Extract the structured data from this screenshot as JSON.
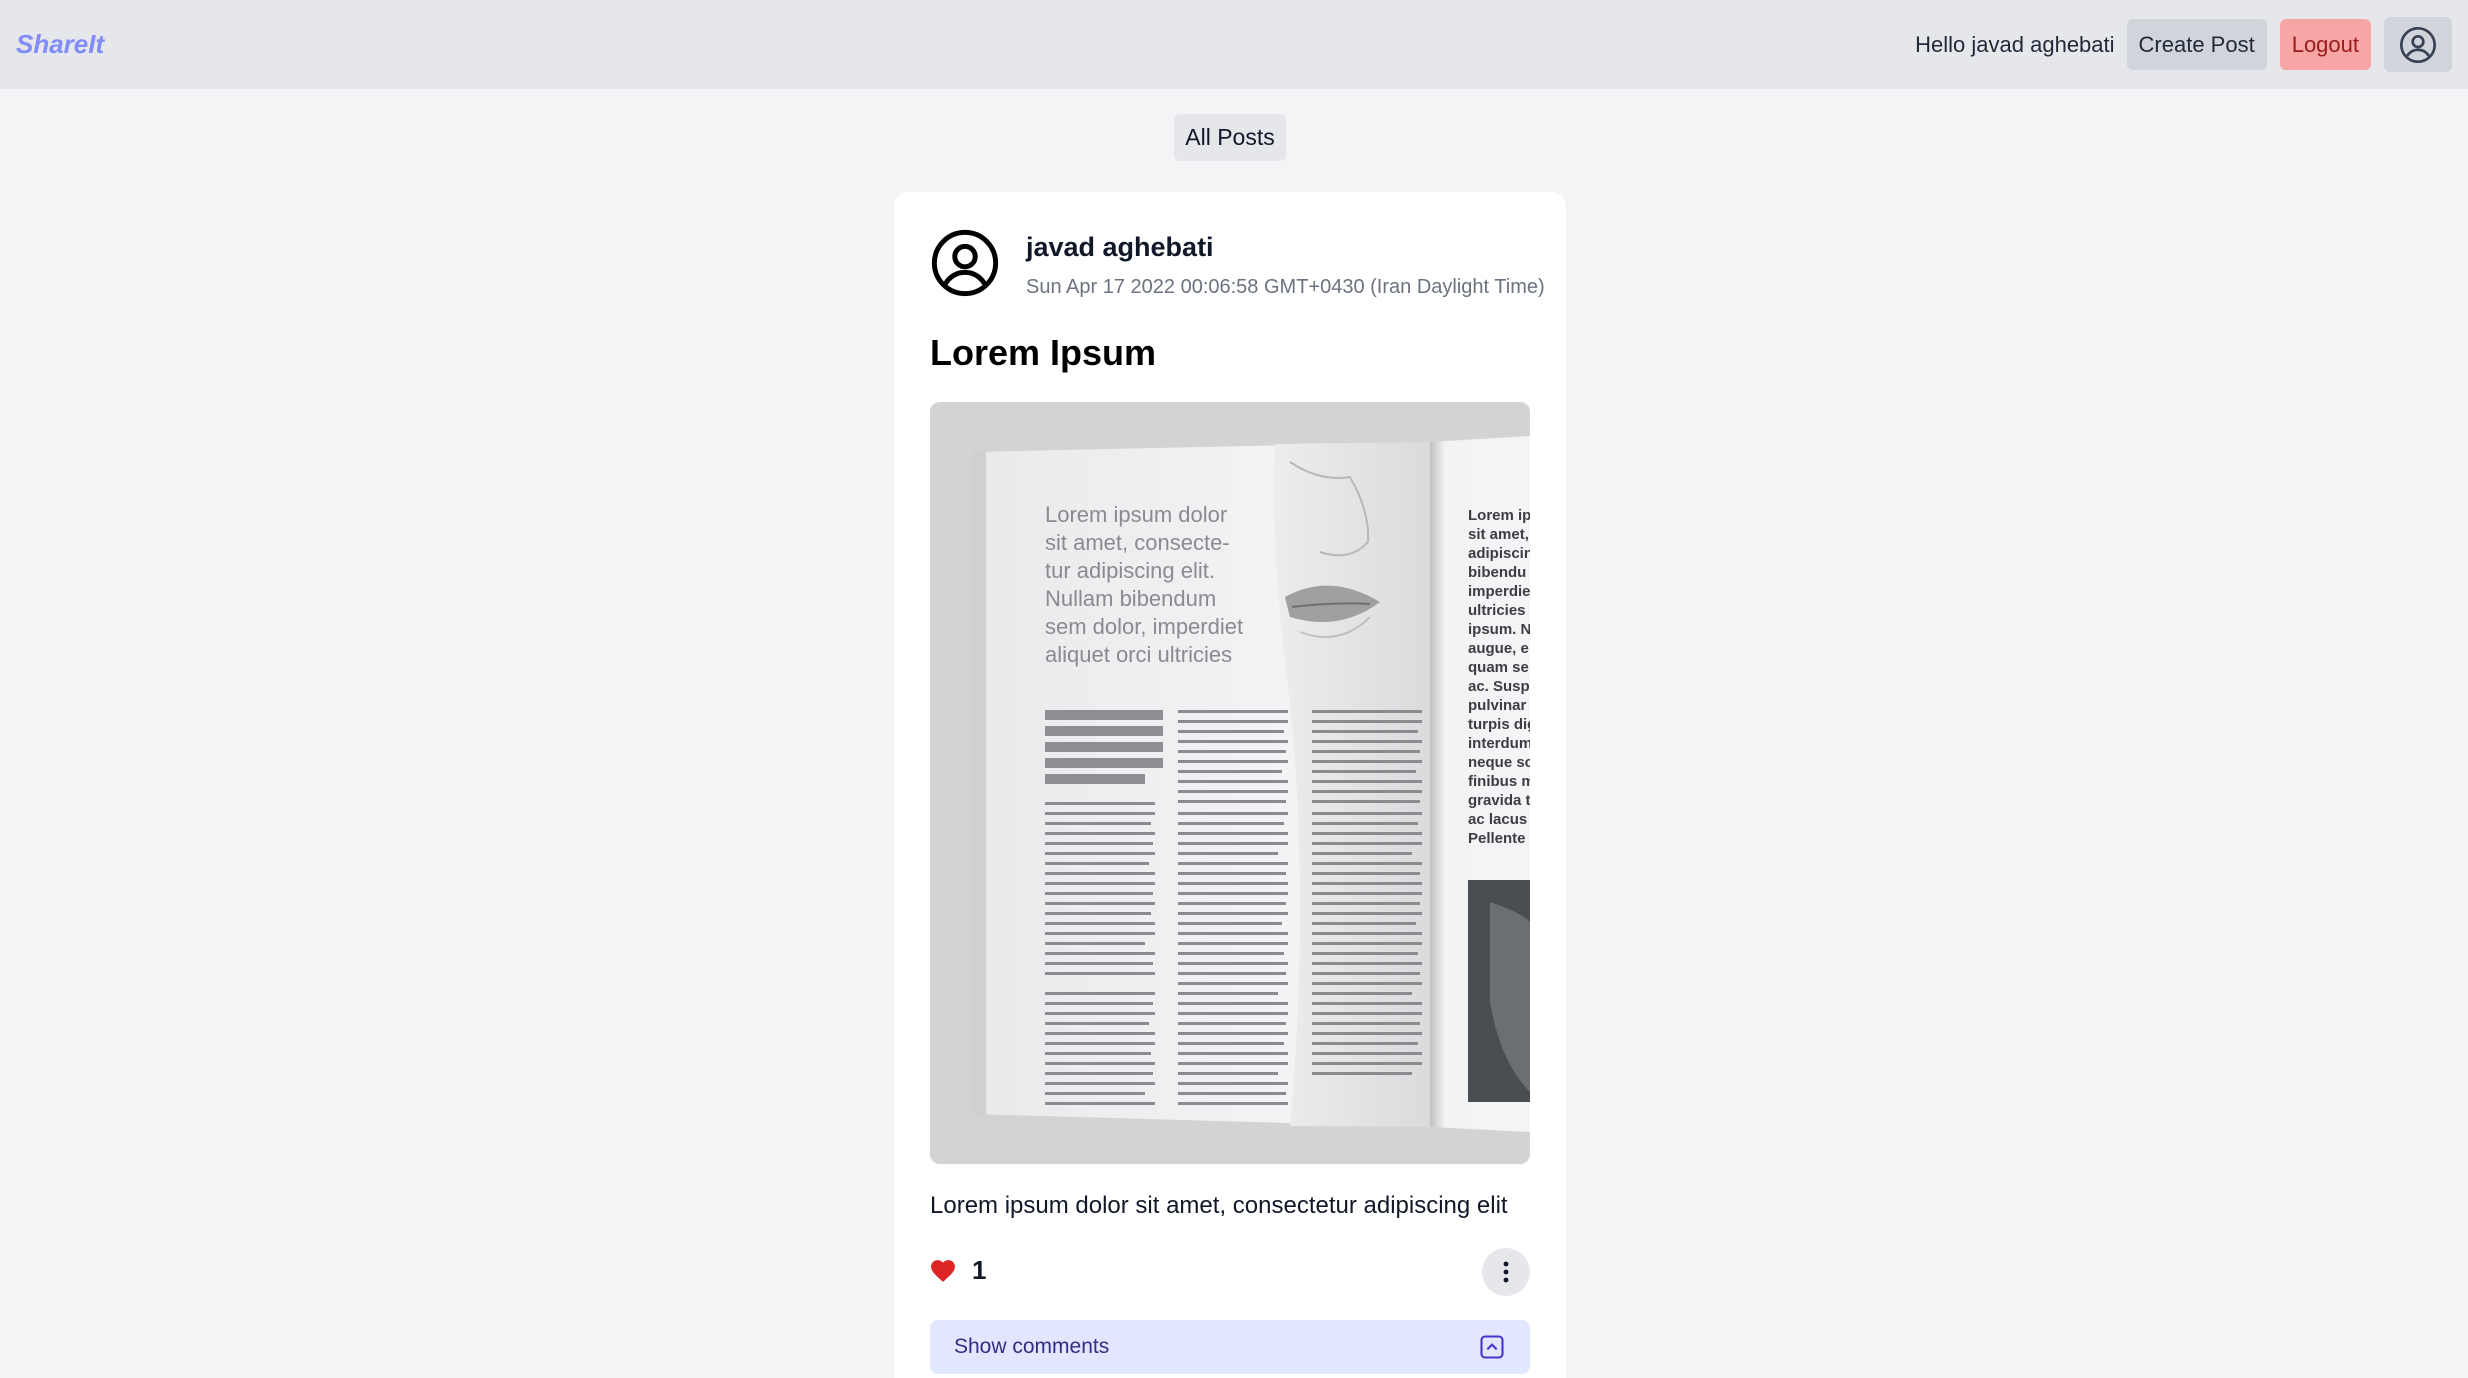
{
  "navbar": {
    "brand": "ShareIt",
    "greeting": "Hello javad aghebati",
    "create_post_label": "Create Post",
    "logout_label": "Logout",
    "avatar_icon": "user-circle-icon"
  },
  "section": {
    "title": "All Posts"
  },
  "post": {
    "author": "javad aghebati",
    "timestamp": "Sun Apr 17 2022 00:06:58 GMT+0430 (Iran Daylight Time)",
    "title": "Lorem Ipsum",
    "body": "Lorem ipsum dolor sit amet, consectetur adipiscing elit",
    "likes": "1",
    "like_icon": "heart-icon",
    "menu_icon": "kebab-menu-icon",
    "image": {
      "headline_lines": [
        "Lorem ipsum dolor",
        "sit amet, consecte-",
        "tur adipiscing elit.",
        "Nullam bibendum",
        "sem dolor, imperdiet",
        "aliquet orci ultricies"
      ],
      "right_page_lines": [
        "Lorem ip",
        "sit amet,",
        "adipiscin",
        "bibendu",
        "imperdie",
        "ultricies",
        "ipsum. N",
        "augue, e",
        "quam se",
        "ac. Susp",
        "pulvinar",
        "turpis dig",
        "interdum",
        "neque sc",
        "finibus m",
        "gravida t",
        "ac lacus",
        "Pellente"
      ]
    }
  },
  "comments": {
    "toggle_label": "Show comments",
    "toggle_icon": "chevron-up-square-icon"
  },
  "colors": {
    "navbar_bg": "#e5e7eb",
    "brand": "#818cf8",
    "logout_bg": "#f8a5a5",
    "like": "#dc2626",
    "comments_bg": "#e0e7ff"
  }
}
